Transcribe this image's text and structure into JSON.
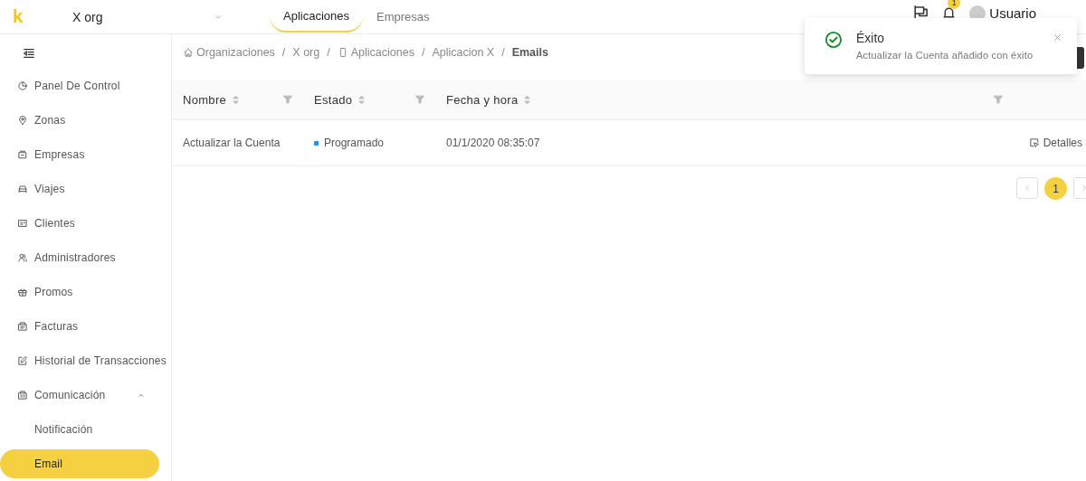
{
  "header": {
    "logo": "k",
    "org_select": {
      "value": "X org"
    },
    "tabs": [
      {
        "label": "Aplicaciones",
        "selected": true
      },
      {
        "label": "Empresas",
        "selected": false
      }
    ],
    "notifications": {
      "badge": "1"
    },
    "user": {
      "name": "Usuario"
    }
  },
  "sidebar": {
    "items": [
      {
        "label": "Panel De Control",
        "selected": false
      },
      {
        "label": "Zonas",
        "selected": false
      },
      {
        "label": "Empresas",
        "selected": false
      },
      {
        "label": "Viajes",
        "selected": false
      },
      {
        "label": "Clientes",
        "selected": false
      },
      {
        "label": "Administradores",
        "selected": false
      },
      {
        "label": "Promos",
        "selected": false
      },
      {
        "label": "Facturas",
        "selected": false
      },
      {
        "label": "Historial de Transacciones",
        "selected": false
      },
      {
        "label": "Comunicación",
        "selected": false,
        "expanded": true,
        "children": [
          {
            "label": "Notificación",
            "selected": false
          },
          {
            "label": "Email",
            "selected": true
          }
        ]
      }
    ]
  },
  "breadcrumb": [
    {
      "label": "Organizaciones",
      "current": false
    },
    {
      "separator": "/",
      "label": "X org",
      "current": false
    },
    {
      "separator": "/",
      "label": "Aplicaciones",
      "current": false
    },
    {
      "separator": "/",
      "label": "Aplicacion X",
      "current": false
    },
    {
      "separator": "/",
      "label": "Emails",
      "current": true
    }
  ],
  "table": {
    "columns": [
      {
        "label": "Nombre",
        "sortable": true,
        "filter": true
      },
      {
        "label": "Estado",
        "sortable": true,
        "filter": true
      },
      {
        "label": "Fecha y hora",
        "sortable": true,
        "filter": true
      }
    ],
    "rows": [
      {
        "name": "Actualizar la Cuenta",
        "status": "Programado",
        "color": "#1890ff",
        "date": "01/1/2020 08:35:07",
        "action": "Detalles"
      }
    ]
  },
  "pagination": {
    "pages": [
      {
        "label": "1",
        "selected": true
      }
    ]
  },
  "toast": {
    "kind": "success",
    "title": "Éxito",
    "message": "Actualizar la Cuenta añadido con éxito"
  }
}
